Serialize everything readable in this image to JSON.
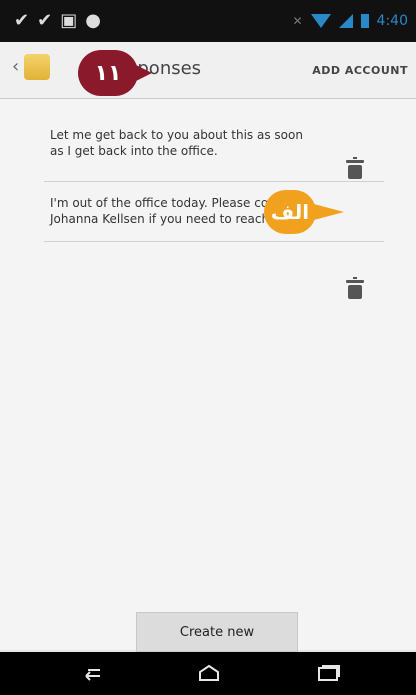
{
  "status_bar": {
    "time": "4:40",
    "icons": [
      "notification-icon",
      "notification-icon",
      "gallery-icon",
      "chat-icon",
      "mute-icon",
      "wifi-icon",
      "signal-icon",
      "battery-icon"
    ]
  },
  "app_bar": {
    "title": "Quick responses",
    "title_visible_suffix": "sponses",
    "add_account_label": "ADD ACCOUNT"
  },
  "responses": [
    {
      "text": "Let me get back to you about this as soon as I get back into the office."
    },
    {
      "text": "I'm out of the office today. Please contact Johanna Kellsen if you need to reach..."
    }
  ],
  "annotations": {
    "number_badge": "١١",
    "letter_callout": "الف"
  },
  "footer": {
    "create_new_label": "Create new"
  }
}
